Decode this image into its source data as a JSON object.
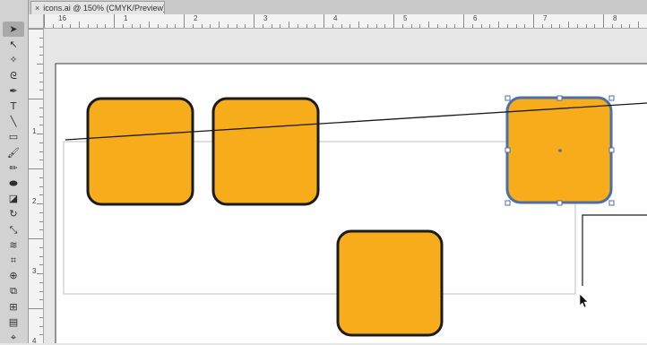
{
  "document_tab": {
    "close_glyph": "×",
    "title": "icons.ai @ 150% (CMYK/Preview)"
  },
  "rulers": {
    "horizontal": [
      "16",
      "1",
      "2",
      "3",
      "4",
      "5",
      "6",
      "7",
      "8"
    ],
    "vertical": [
      "1",
      "2",
      "3",
      "4"
    ]
  },
  "tools": [
    {
      "name": "selection-tool-icon",
      "glyph": "➤",
      "active": true
    },
    {
      "name": "direct-selection-tool-icon",
      "glyph": "↖"
    },
    {
      "name": "magic-wand-tool-icon",
      "glyph": "✧"
    },
    {
      "name": "lasso-tool-icon",
      "glyph": "ᘓ"
    },
    {
      "name": "pen-tool-icon",
      "glyph": "✒"
    },
    {
      "name": "type-tool-icon",
      "glyph": "T"
    },
    {
      "name": "line-segment-tool-icon",
      "glyph": "╲"
    },
    {
      "name": "rectangle-tool-icon",
      "glyph": "▭"
    },
    {
      "name": "paintbrush-tool-icon",
      "glyph": "🖌"
    },
    {
      "name": "pencil-tool-icon",
      "glyph": "✏"
    },
    {
      "name": "blob-brush-tool-icon",
      "glyph": "⬬"
    },
    {
      "name": "eraser-tool-icon",
      "glyph": "◪"
    },
    {
      "name": "rotate-tool-icon",
      "glyph": "↻"
    },
    {
      "name": "scale-tool-icon",
      "glyph": "⤡"
    },
    {
      "name": "warp-tool-icon",
      "glyph": "≋"
    },
    {
      "name": "free-transform-tool-icon",
      "glyph": "⌗"
    },
    {
      "name": "shape-builder-tool-icon",
      "glyph": "⊕"
    },
    {
      "name": "perspective-grid-tool-icon",
      "glyph": "⧉"
    },
    {
      "name": "mesh-tool-icon",
      "glyph": "⊞"
    },
    {
      "name": "gradient-tool-icon",
      "glyph": "▤"
    },
    {
      "name": "eyedropper-tool-icon",
      "glyph": "⌖"
    }
  ],
  "colors": {
    "shape_fill": "#f7ac1c",
    "shape_stroke": "#1b1b1b",
    "selection": "#4c6fa8"
  }
}
